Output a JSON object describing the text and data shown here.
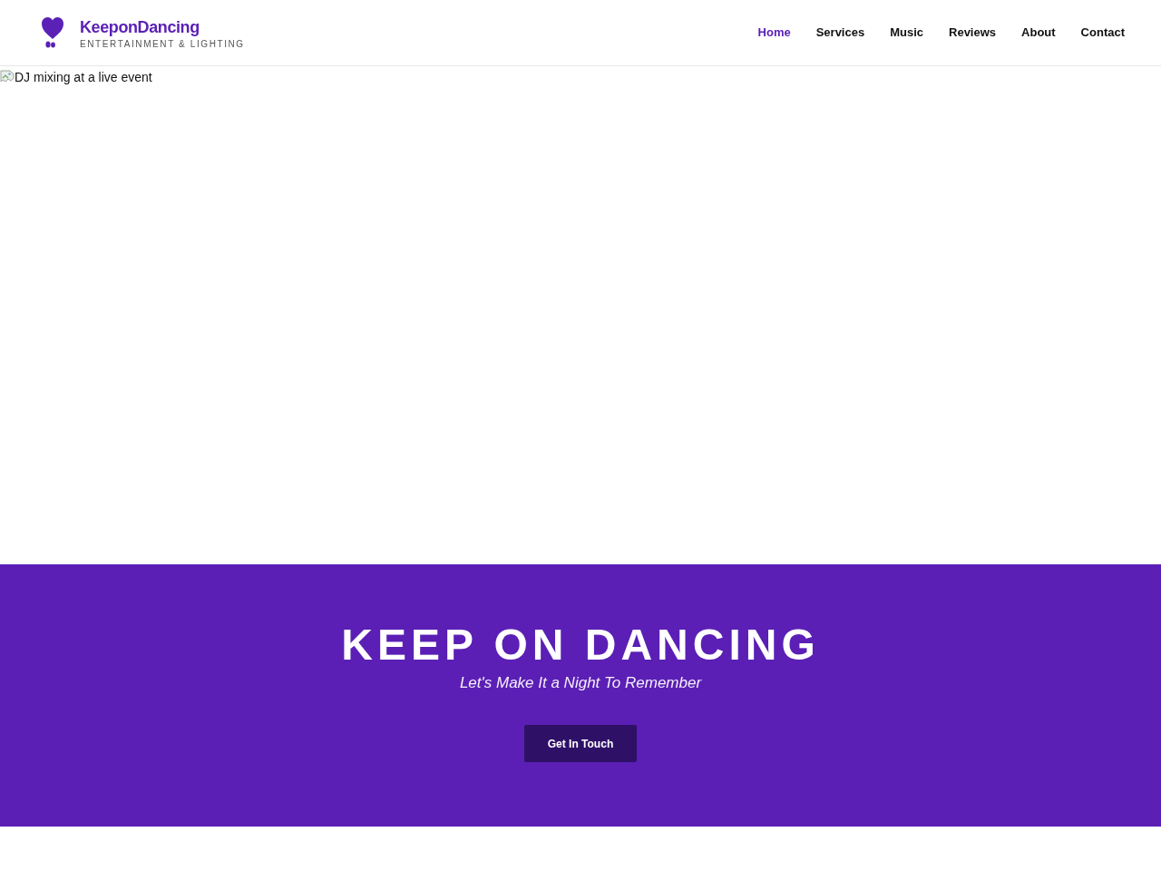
{
  "header": {
    "brand": {
      "name": "KeeponDancing",
      "tagline": "ENTERTAINMENT & LIGHTING"
    },
    "nav": [
      {
        "label": "Home",
        "selected": true
      },
      {
        "label": "Services",
        "selected": false
      },
      {
        "label": "Music",
        "selected": false
      },
      {
        "label": "Reviews",
        "selected": false
      },
      {
        "label": "About",
        "selected": false
      },
      {
        "label": "Contact",
        "selected": false
      }
    ]
  },
  "hero_image": {
    "alt_text": "DJ mixing at a live event"
  },
  "banner": {
    "title": "KEEP ON DANCING",
    "subtitle": "Let's Make It a Night To Remember",
    "button": "Get In Touch"
  }
}
